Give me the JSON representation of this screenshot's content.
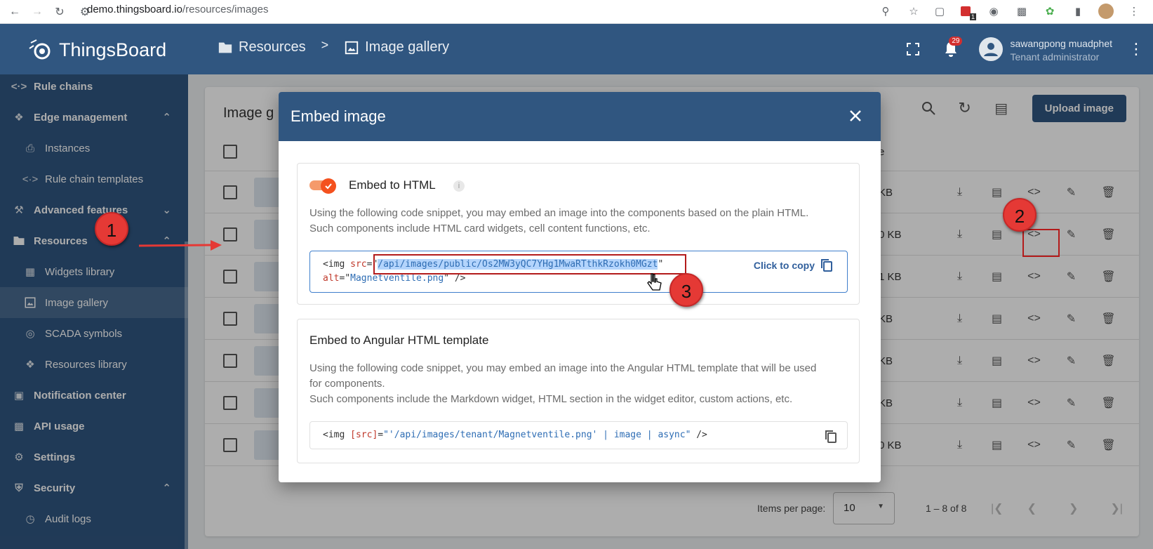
{
  "browser": {
    "url_host": "demo.thingsboard.io",
    "url_path": "/resources/images",
    "extension_badge": "1"
  },
  "header": {
    "logo_text": "ThingsBoard",
    "breadcrumb": [
      {
        "label": "Resources",
        "icon": "folder-icon"
      },
      {
        "label": "Image gallery",
        "icon": "image-icon"
      }
    ],
    "breadcrumb_separator": ">",
    "notification_count": "29",
    "user_name": "sawangpong muadphet",
    "user_role": "Tenant administrator"
  },
  "sidebar": {
    "items": [
      {
        "label": "Rule chains",
        "icon": "rule-chain-icon",
        "level": 0
      },
      {
        "label": "Edge management",
        "icon": "edge-icon",
        "level": 0,
        "chevron": "up"
      },
      {
        "label": "Instances",
        "icon": "router-icon",
        "level": 1
      },
      {
        "label": "Rule chain templates",
        "icon": "rule-chain-icon",
        "level": 1
      },
      {
        "label": "Advanced features",
        "icon": "tools-icon",
        "level": 0,
        "chevron": "down"
      },
      {
        "label": "Resources",
        "icon": "folder-icon",
        "level": 0,
        "chevron": "up"
      },
      {
        "label": "Widgets library",
        "icon": "widgets-icon",
        "level": 1
      },
      {
        "label": "Image gallery",
        "icon": "image-icon",
        "level": 1,
        "active": true
      },
      {
        "label": "SCADA symbols",
        "icon": "scada-icon",
        "level": 1
      },
      {
        "label": "Resources library",
        "icon": "resources-icon",
        "level": 1
      },
      {
        "label": "Notification center",
        "icon": "notification-icon",
        "level": 0
      },
      {
        "label": "API usage",
        "icon": "chart-icon",
        "level": 0
      },
      {
        "label": "Settings",
        "icon": "gear-icon",
        "level": 0
      },
      {
        "label": "Security",
        "icon": "shield-icon",
        "level": 0,
        "chevron": "up"
      },
      {
        "label": "Audit logs",
        "icon": "audit-icon",
        "level": 1
      }
    ]
  },
  "gallery": {
    "title": "Image g",
    "upload_label": "Upload image",
    "size_header": "e",
    "rows": [
      {
        "size": "KB"
      },
      {
        "size": "0 KB"
      },
      {
        "size": "1 KB"
      },
      {
        "size": "KB"
      },
      {
        "size": "KB"
      },
      {
        "size": "KB"
      },
      {
        "size": "0 KB"
      }
    ],
    "items_per_page_label": "Items per page:",
    "items_per_page_value": "10",
    "range_label": "1 – 8 of 8"
  },
  "dialog": {
    "title": "Embed image",
    "html_section": {
      "title": "Embed to HTML",
      "toggle_on": true,
      "description_line1": "Using the following code snippet, you may embed an image into the components based on the plain HTML.",
      "description_line2": "Such components include HTML card widgets, cell content functions, etc.",
      "code_tag_open": "<img",
      "code_src_attr": "src",
      "code_eq": "=",
      "code_quote": "\"",
      "code_src_value": "/api/images/public/Os2MW3yQC7YHg1MwaRTthkRzokh0MGzt",
      "code_alt_attr": "alt",
      "code_alt_value": "Magnetventile.png",
      "code_tag_close": " />",
      "copy_label": "Click to copy"
    },
    "angular_section": {
      "title": "Embed to Angular HTML template",
      "description_line1": "Using the following code snippet, you may embed an image into the Angular HTML template that will be used",
      "description_line2": "for components.",
      "description_line3": "Such components include the Markdown widget, HTML section in the widget editor, custom actions, etc.",
      "code_tag_open": "<img",
      "code_attr": "[src]",
      "code_eq": "=",
      "code_value": "\"'/api/images/tenant/Magnetventile.png' | image | async\"",
      "code_tag_close": " />"
    }
  },
  "annotations": {
    "badge1": "1",
    "badge2": "2",
    "badge3": "3",
    "color": "#e53935"
  }
}
